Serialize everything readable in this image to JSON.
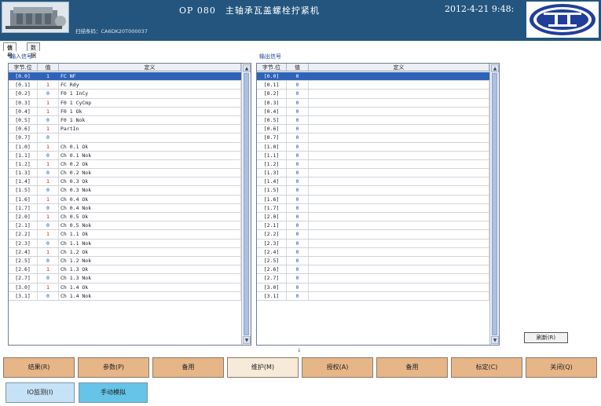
{
  "header": {
    "title": "OP 080　主轴承瓦盖螺栓拧紧机",
    "datetime": "2012-4-21 9:48:",
    "barcode_label": "扫描条码：CA6DK20T000037"
  },
  "tabs": [
    {
      "label": "信号"
    },
    {
      "label": "数据"
    }
  ],
  "input_panel": {
    "title": "输入信号",
    "columns": [
      "字节.位",
      "值",
      "定义"
    ],
    "rows": [
      {
        "byte": "[0.0]",
        "value": "1",
        "def": "FC NF"
      },
      {
        "byte": "[0.1]",
        "value": "1",
        "def": "FC Rdy"
      },
      {
        "byte": "[0.2]",
        "value": "0",
        "def": "F0 1 InCy"
      },
      {
        "byte": "[0.3]",
        "value": "1",
        "def": "F0 1 CyCmp"
      },
      {
        "byte": "[0.4]",
        "value": "1",
        "def": "F0 1 Ok"
      },
      {
        "byte": "[0.5]",
        "value": "0",
        "def": "F0 1 Nok"
      },
      {
        "byte": "[0.6]",
        "value": "1",
        "def": "PartIn"
      },
      {
        "byte": "[0.7]",
        "value": "0",
        "def": ""
      },
      {
        "byte": "[1.0]",
        "value": "1",
        "def": "Ch 0.1 Ok"
      },
      {
        "byte": "[1.1]",
        "value": "0",
        "def": "Ch 0.1 Nok"
      },
      {
        "byte": "[1.2]",
        "value": "1",
        "def": "Ch 0.2 Ok"
      },
      {
        "byte": "[1.3]",
        "value": "0",
        "def": "Ch 0.2 Nok"
      },
      {
        "byte": "[1.4]",
        "value": "1",
        "def": "Ch 0.3 Ok"
      },
      {
        "byte": "[1.5]",
        "value": "0",
        "def": "Ch 0.3 Nok"
      },
      {
        "byte": "[1.6]",
        "value": "1",
        "def": "Ch 0.4 Ok"
      },
      {
        "byte": "[1.7]",
        "value": "0",
        "def": "Ch 0.4 Nok"
      },
      {
        "byte": "[2.0]",
        "value": "1",
        "def": "Ch 0.5 Ok"
      },
      {
        "byte": "[2.1]",
        "value": "0",
        "def": "Ch 0.5 Nok"
      },
      {
        "byte": "[2.2]",
        "value": "1",
        "def": "Ch 1.1 Ok"
      },
      {
        "byte": "[2.3]",
        "value": "0",
        "def": "Ch 1.1 Nok"
      },
      {
        "byte": "[2.4]",
        "value": "1",
        "def": "Ch 1.2 Ok"
      },
      {
        "byte": "[2.5]",
        "value": "0",
        "def": "Ch 1.2 Nok"
      },
      {
        "byte": "[2.6]",
        "value": "1",
        "def": "Ch 1.3 Ok"
      },
      {
        "byte": "[2.7]",
        "value": "0",
        "def": "Ch 1.3 Nok"
      },
      {
        "byte": "[3.0]",
        "value": "1",
        "def": "Ch 1.4 Ok"
      },
      {
        "byte": "[3.1]",
        "value": "0",
        "def": "Ch 1.4 Nok"
      }
    ]
  },
  "output_panel": {
    "title": "输出信号",
    "columns": [
      "字节.位",
      "值",
      "定义"
    ],
    "rows": [
      {
        "byte": "[0.0]",
        "value": "0",
        "def": ""
      },
      {
        "byte": "[0.1]",
        "value": "0",
        "def": ""
      },
      {
        "byte": "[0.2]",
        "value": "0",
        "def": ""
      },
      {
        "byte": "[0.3]",
        "value": "0",
        "def": ""
      },
      {
        "byte": "[0.4]",
        "value": "0",
        "def": ""
      },
      {
        "byte": "[0.5]",
        "value": "0",
        "def": ""
      },
      {
        "byte": "[0.6]",
        "value": "0",
        "def": ""
      },
      {
        "byte": "[0.7]",
        "value": "0",
        "def": ""
      },
      {
        "byte": "[1.0]",
        "value": "0",
        "def": ""
      },
      {
        "byte": "[1.1]",
        "value": "0",
        "def": ""
      },
      {
        "byte": "[1.2]",
        "value": "0",
        "def": ""
      },
      {
        "byte": "[1.3]",
        "value": "0",
        "def": ""
      },
      {
        "byte": "[1.4]",
        "value": "0",
        "def": ""
      },
      {
        "byte": "[1.5]",
        "value": "0",
        "def": ""
      },
      {
        "byte": "[1.6]",
        "value": "0",
        "def": ""
      },
      {
        "byte": "[1.7]",
        "value": "0",
        "def": ""
      },
      {
        "byte": "[2.0]",
        "value": "0",
        "def": ""
      },
      {
        "byte": "[2.1]",
        "value": "0",
        "def": ""
      },
      {
        "byte": "[2.2]",
        "value": "0",
        "def": ""
      },
      {
        "byte": "[2.3]",
        "value": "0",
        "def": ""
      },
      {
        "byte": "[2.4]",
        "value": "0",
        "def": ""
      },
      {
        "byte": "[2.5]",
        "value": "0",
        "def": ""
      },
      {
        "byte": "[2.6]",
        "value": "0",
        "def": ""
      },
      {
        "byte": "[2.7]",
        "value": "0",
        "def": ""
      },
      {
        "byte": "[3.0]",
        "value": "0",
        "def": ""
      },
      {
        "byte": "[3.1]",
        "value": "0",
        "def": ""
      }
    ]
  },
  "refresh_label": "刷新(R)",
  "function_buttons": [
    {
      "label": "结果(R)"
    },
    {
      "label": "参数(P)"
    },
    {
      "label": "备用"
    },
    {
      "label": "维护(M)"
    },
    {
      "label": "授权(A)"
    },
    {
      "label": "备用"
    },
    {
      "label": "标定(C)"
    },
    {
      "label": "关闭(Q)"
    }
  ],
  "mode_buttons": {
    "io_monitor": "IO监测(I)",
    "manual_sim": "手动模拟"
  },
  "colors": {
    "header_bg": "#23557f",
    "selected_row": "#2f63b8",
    "function_button": "#e6b588",
    "function_button_active": "#f6ead8",
    "io_button": "#c6e2f6",
    "sim_button": "#65c4e8"
  }
}
